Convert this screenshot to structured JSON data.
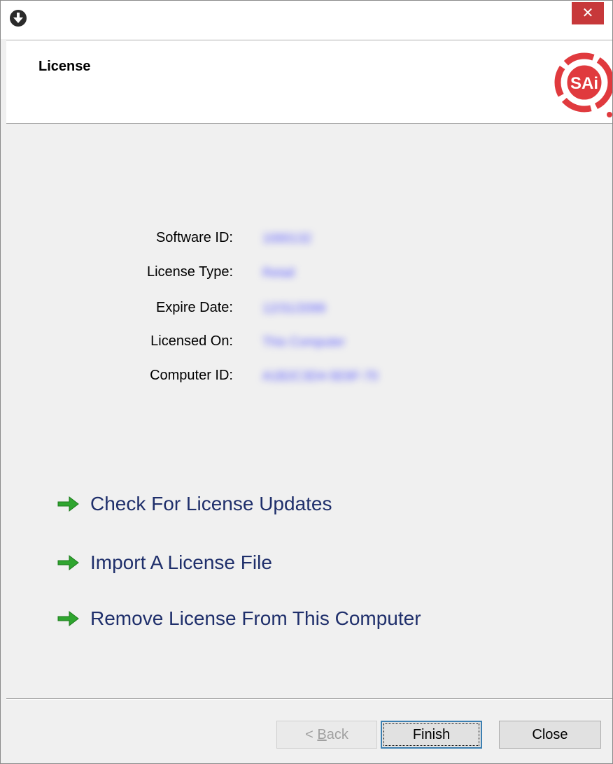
{
  "window": {
    "close_glyph": "✕"
  },
  "header": {
    "title": "License",
    "logo_text": "SAi"
  },
  "license_info": [
    {
      "label": "Software ID:",
      "value": "1000132"
    },
    {
      "label": "License Type:",
      "value": "Retail"
    },
    {
      "label": "Expire Date:",
      "value": "12/31/2099"
    },
    {
      "label": "Licensed On:",
      "value": "This Computer"
    },
    {
      "label": "Computer ID:",
      "value": "A1B2C3D4-5E6F-70"
    }
  ],
  "actions": [
    {
      "label": "Check For License Updates",
      "icon": "green-arrow-icon"
    },
    {
      "label": "Import A License File",
      "icon": "green-arrow-icon"
    },
    {
      "label": "Remove License From This Computer",
      "icon": "green-arrow-icon"
    }
  ],
  "buttons": {
    "back_prefix": "< ",
    "back_mnemonic": "B",
    "back_rest": "ack",
    "finish": "Finish",
    "close": "Close"
  },
  "colors": {
    "accent_red": "#e03a3e",
    "arrow_green": "#2fa52f",
    "link_blue": "#1f2f6b"
  }
}
